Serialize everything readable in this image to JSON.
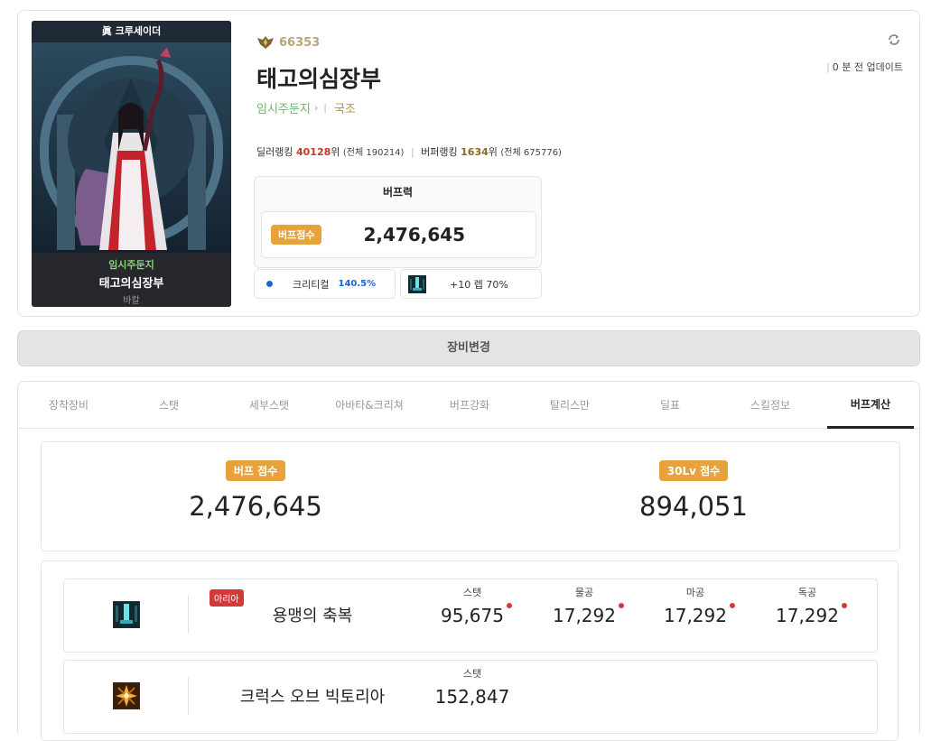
{
  "profile": {
    "job_title": "眞 크루세이더",
    "adventure_name": "임시주둔지",
    "character_name": "태고의심장부",
    "server": "바칼",
    "fame": "66353",
    "guild": "국조",
    "updated": "0 분 전 업데이트",
    "dealer_rank_label": "딜러랭킹",
    "dealer_rank": "40128",
    "rank_suffix": "위",
    "dealer_total": "(전체 190214)",
    "buffer_rank_label": "버퍼랭킹",
    "buffer_rank": "1634",
    "buffer_total": "(전체 675776)",
    "buffbox_title": "버프력",
    "buff_score_label": "버프점수",
    "buff_score": "2,476,645",
    "crit_label": "크리티컬",
    "crit_value": "140.5%",
    "skill_level": "+10 렙 70%"
  },
  "equip_button": "장비변경",
  "tabs": [
    "장착장비",
    "스탯",
    "세부스탯",
    "아바타&크리쳐",
    "버프강화",
    "탈리스만",
    "딜표",
    "스킬정보",
    "버프계산"
  ],
  "active_tab": "버프계산",
  "scores": [
    {
      "label": "버프 점수",
      "value": "2,476,645"
    },
    {
      "label": "30Lv 점수",
      "value": "894,051"
    }
  ],
  "buffs": [
    {
      "name": "용맹의 축복",
      "tag": "아리아",
      "icon": "dragon-blessing-icon",
      "stats": [
        {
          "label": "스탯",
          "value": "95,675"
        },
        {
          "label": "물공",
          "value": "17,292"
        },
        {
          "label": "마공",
          "value": "17,292"
        },
        {
          "label": "독공",
          "value": "17,292"
        }
      ]
    },
    {
      "name": "크럭스 오브 빅토리아",
      "icon": "crux-victoria-icon",
      "stats": [
        {
          "label": "스탯",
          "value": "152,847"
        }
      ]
    }
  ],
  "colors": {
    "badge": "#e8a23b",
    "crit": "#1a66d4",
    "dealer_rank": "#c0392b",
    "buffer_rank": "#8a6a20",
    "adventure": "#6db56d",
    "tag": "#d23a3a"
  }
}
